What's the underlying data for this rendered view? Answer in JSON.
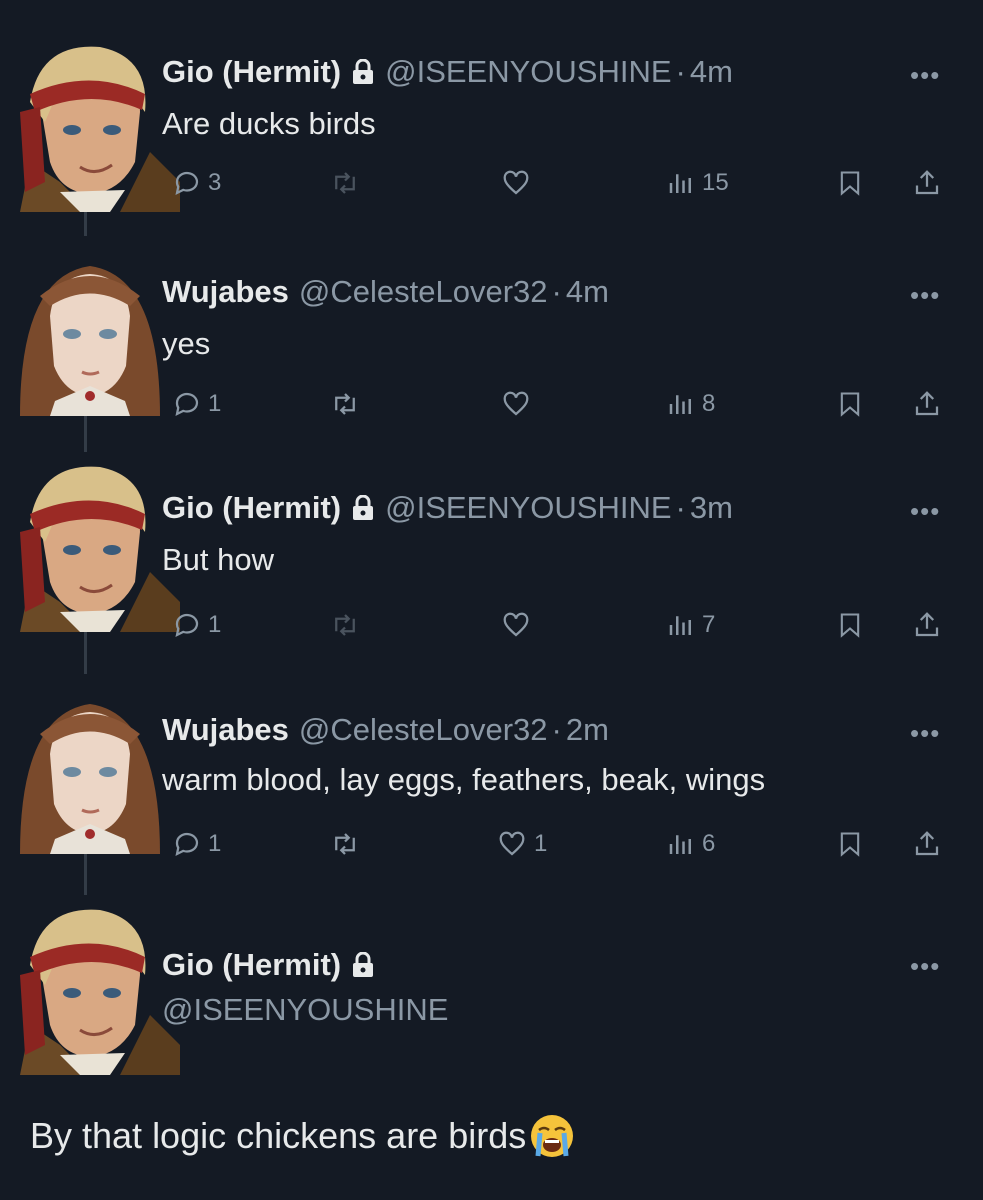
{
  "tweets": [
    {
      "name": "Gio (Hermit)",
      "handle": "@ISEENYOUSHINE",
      "sep": "·",
      "time": "4m",
      "text": "Are ducks birds",
      "replies": "3",
      "retweets": "",
      "likes": "",
      "views": "15",
      "locked": true,
      "avatar": "gio-avatar"
    },
    {
      "name": "Wujabes",
      "handle": "@CelesteLover32",
      "sep": "·",
      "time": "4m",
      "text": "yes",
      "replies": "1",
      "retweets": "",
      "likes": "",
      "views": "8",
      "locked": false,
      "avatar": "wujabes-avatar"
    },
    {
      "name": "Gio (Hermit)",
      "handle": "@ISEENYOUSHINE",
      "sep": "·",
      "time": "3m",
      "text": "But how",
      "replies": "1",
      "retweets": "",
      "likes": "",
      "views": "7",
      "locked": true,
      "avatar": "gio-avatar"
    },
    {
      "name": "Wujabes",
      "handle": "@CelesteLover32",
      "sep": "·",
      "time": "2m",
      "text": "warm blood, lay eggs, feathers, beak, wings",
      "replies": "1",
      "retweets": "",
      "likes": "1",
      "views": "6",
      "locked": false,
      "avatar": "wujabes-avatar"
    }
  ],
  "draft": {
    "name": "Gio (Hermit)",
    "handle": "@ISEENYOUSHINE",
    "text": "By that logic chickens are birds",
    "emoji": "loudly-crying-face",
    "locked": true
  },
  "more_label": "•••",
  "icons": {
    "reply": "reply-icon",
    "retweet": "retweet-icon",
    "like": "heart-icon",
    "views": "views-icon",
    "bookmark": "bookmark-icon",
    "share": "share-icon",
    "lock": "lock-icon"
  },
  "colors": {
    "background": "#141a24",
    "text": "#e7e9ea",
    "muted": "#8b98a5",
    "thread_line": "#333c47"
  }
}
